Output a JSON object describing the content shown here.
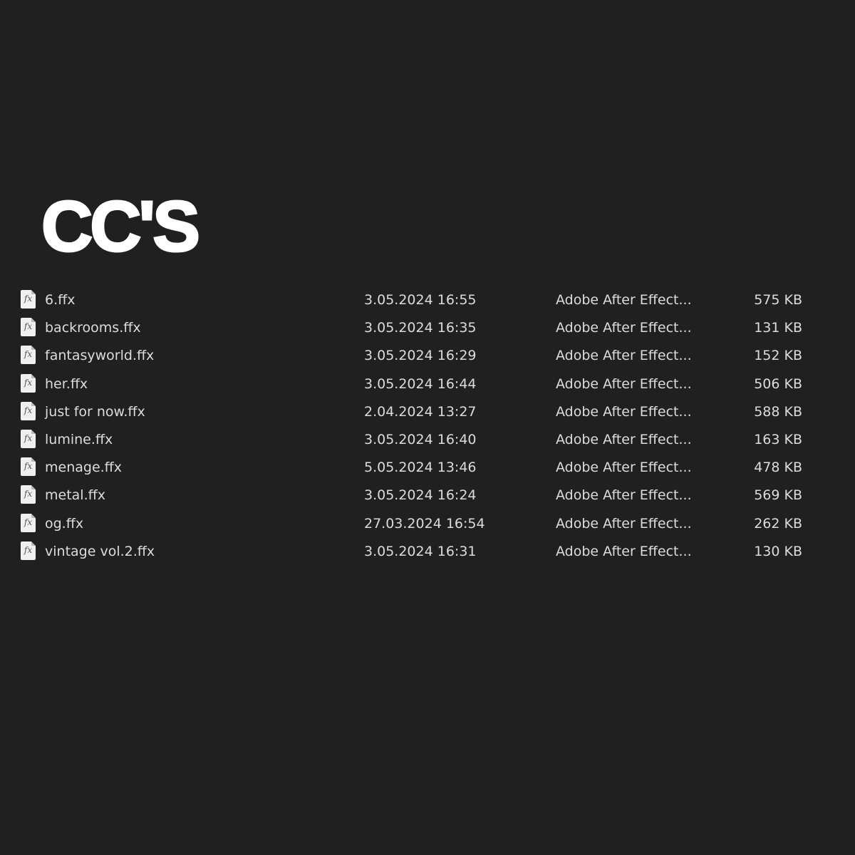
{
  "title": "CC'S",
  "files": [
    {
      "name": "6.ffx",
      "date": "3.05.2024 16:55",
      "type": "Adobe After Effect...",
      "size": "575 KB"
    },
    {
      "name": "backrooms.ffx",
      "date": "3.05.2024 16:35",
      "type": "Adobe After Effect...",
      "size": "131 KB"
    },
    {
      "name": "fantasyworld.ffx",
      "date": "3.05.2024 16:29",
      "type": "Adobe After Effect...",
      "size": "152 KB"
    },
    {
      "name": "her.ffx",
      "date": "3.05.2024 16:44",
      "type": "Adobe After Effect...",
      "size": "506 KB"
    },
    {
      "name": "just for now.ffx",
      "date": "2.04.2024 13:27",
      "type": "Adobe After Effect...",
      "size": "588 KB"
    },
    {
      "name": "lumine.ffx",
      "date": "3.05.2024 16:40",
      "type": "Adobe After Effect...",
      "size": "163 KB"
    },
    {
      "name": "menage.ffx",
      "date": "5.05.2024 13:46",
      "type": "Adobe After Effect...",
      "size": "478 KB"
    },
    {
      "name": "metal.ffx",
      "date": "3.05.2024 16:24",
      "type": "Adobe After Effect...",
      "size": "569 KB"
    },
    {
      "name": "og.ffx",
      "date": "27.03.2024 16:54",
      "type": "Adobe After Effect...",
      "size": "262 KB"
    },
    {
      "name": "vintage vol.2.ffx",
      "date": "3.05.2024 16:31",
      "type": "Adobe After Effect...",
      "size": "130 KB"
    }
  ],
  "icon_glyph": "fx",
  "icon": "ffx-file-icon"
}
